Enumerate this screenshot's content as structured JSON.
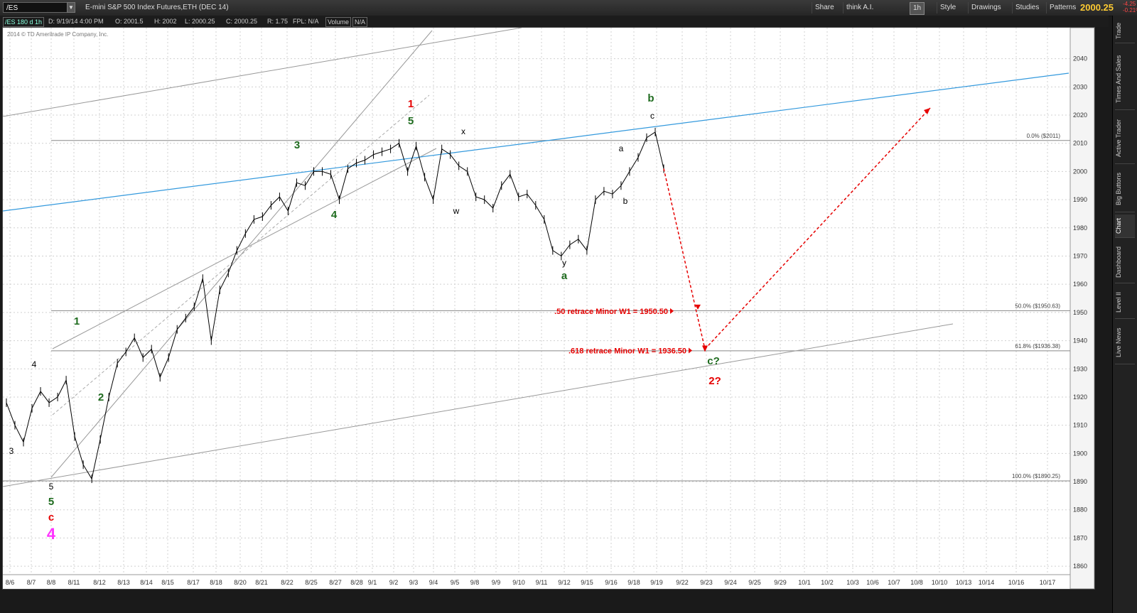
{
  "toolbar": {
    "symbol": "/ES",
    "description": "E-mini S&P 500 Index Futures,ETH (DEC 14)",
    "buttons": [
      "Share",
      "think A.I.",
      "1h",
      "Style",
      "Drawings",
      "Studies",
      "Patterns"
    ],
    "last_price": "2000.25",
    "change_abs": "-4.25",
    "change_pct": "-0.21%"
  },
  "infobar": {
    "series_label": "/ES 180 d 1h",
    "date": "D: 9/19/14 4:00 PM",
    "open": "O: 2001.5",
    "high": "H: 2002",
    "low": "L: 2000.25",
    "close": "C: 2000.25",
    "range": "R: 1.75",
    "fpl": "FPL: N/A",
    "volume": "Volume",
    "volume_value": "N/A"
  },
  "sidebar": {
    "tabs": [
      "Trade",
      "Times And Sales",
      "Active Trader",
      "Big Buttons",
      "Chart",
      "Dashboard",
      "Level II",
      "Live News"
    ]
  },
  "chart_data": {
    "type": "line",
    "copyright": "2014 © TD Ameritrade IP Company, Inc.",
    "x_ticks": [
      "8/6",
      "8/7",
      "8/8",
      "8/11",
      "8/12",
      "8/13",
      "8/14",
      "8/15",
      "8/17",
      "8/18",
      "8/20",
      "8/21",
      "8/22",
      "8/25",
      "8/27",
      "8/28",
      "9/1",
      "9/2",
      "9/3",
      "9/4",
      "9/5",
      "9/8",
      "9/9",
      "9/10",
      "9/11",
      "9/12",
      "9/15",
      "9/16",
      "9/18",
      "9/19",
      "9/22",
      "9/23",
      "9/24",
      "9/25",
      "9/29",
      "10/1",
      "10/2",
      "10/3",
      "10/6",
      "10/7",
      "10/8",
      "10/10",
      "10/13",
      "10/14",
      "10/16",
      "10/17"
    ],
    "y_ticks": [
      1860,
      1870,
      1880,
      1890,
      1900,
      1910,
      1920,
      1930,
      1940,
      1950,
      1960,
      1970,
      1980,
      1990,
      2000,
      2010,
      2020,
      2030,
      2040
    ],
    "ylim": [
      1857,
      2051
    ],
    "series": [
      {
        "x": [
          0,
          1,
          2,
          3,
          4,
          5,
          6,
          7,
          8,
          9,
          10,
          11,
          12,
          13,
          14,
          15,
          16,
          17,
          18,
          19,
          20,
          21,
          22,
          23,
          24,
          25,
          26,
          27,
          28,
          29,
          30,
          31,
          32,
          33,
          34,
          35,
          36,
          37,
          38,
          39,
          40,
          41,
          42,
          43,
          44,
          45,
          46,
          47,
          48,
          49,
          50,
          51,
          52,
          53,
          54,
          55,
          56,
          57,
          58,
          59,
          60,
          61,
          62,
          63,
          64,
          65,
          66,
          67,
          68,
          69,
          70,
          71,
          72,
          73,
          74,
          75,
          76,
          77
        ],
        "values": [
          1918,
          1910,
          1904,
          1916,
          1922,
          1918,
          1920,
          1926,
          1906,
          1896,
          1891,
          1905,
          1920,
          1932,
          1936,
          1941,
          1934,
          1937,
          1927,
          1934,
          1944,
          1948,
          1952,
          1962,
          1940,
          1958,
          1964,
          1972,
          1978,
          1983,
          1984,
          1988,
          1991,
          1986,
          1996,
          1995,
          2000,
          2000,
          1999,
          1990,
          2001,
          2003,
          2004,
          2006,
          2007,
          2008,
          2010,
          2000,
          2009,
          1998,
          1990,
          2008,
          2006,
          2002,
          2000,
          1991,
          1990,
          1987,
          1995,
          1999,
          1991,
          1992,
          1988,
          1983,
          1972,
          1970,
          1974,
          1976,
          1972,
          1990,
          1993,
          1992,
          1995,
          2000,
          2005,
          2012,
          2014,
          2001
        ]
      }
    ],
    "fib_levels": [
      {
        "label": "0.0%  ($2011)",
        "value": 2011
      },
      {
        "label": "50.0%  ($1950.63)",
        "value": 1950.63
      },
      {
        "label": "61.8%  ($1936.38)",
        "value": 1936.38
      },
      {
        "label": "100.0%  ($1890.25)",
        "value": 1890.25
      }
    ],
    "target_annotations": [
      {
        "text": ".50 retrace Minor W1 = 1950.50",
        "value": 1950.5
      },
      {
        "text": ".618 retrace Minor W1 = 1936.50",
        "value": 1936.5
      }
    ],
    "wave_labels": [
      {
        "text": "3",
        "color": "#000000",
        "size": "s"
      },
      {
        "text": "4",
        "color": "#000000",
        "size": "s"
      },
      {
        "text": "5",
        "color": "#000000",
        "size": "s"
      },
      {
        "text": "5",
        "color": "#1e6b1e",
        "size": "m"
      },
      {
        "text": "c",
        "color": "#e60000",
        "size": "m"
      },
      {
        "text": "4",
        "color": "#ff33ff",
        "size": "l"
      },
      {
        "text": "1",
        "color": "#1e6b1e",
        "size": "m"
      },
      {
        "text": "2",
        "color": "#1e6b1e",
        "size": "m"
      },
      {
        "text": "3",
        "color": "#1e6b1e",
        "size": "m"
      },
      {
        "text": "4",
        "color": "#1e6b1e",
        "size": "m"
      },
      {
        "text": "5",
        "color": "#1e6b1e",
        "size": "m"
      },
      {
        "text": "1",
        "color": "#e60000",
        "size": "m"
      },
      {
        "text": "x",
        "color": "#000000",
        "size": "s"
      },
      {
        "text": "w",
        "color": "#000000",
        "size": "s"
      },
      {
        "text": "y",
        "color": "#000000",
        "size": "s"
      },
      {
        "text": "a",
        "color": "#1e6b1e",
        "size": "m"
      },
      {
        "text": "a",
        "color": "#000000",
        "size": "s"
      },
      {
        "text": "b",
        "color": "#000000",
        "size": "s"
      },
      {
        "text": "c",
        "color": "#000000",
        "size": "s"
      },
      {
        "text": "b",
        "color": "#1e6b1e",
        "size": "m"
      },
      {
        "text": "c?",
        "color": "#1e6b1e",
        "size": "m"
      },
      {
        "text": "2?",
        "color": "#e60000",
        "size": "m"
      }
    ],
    "colors": {
      "price": "#000000",
      "trendline_blue": "#3399dd",
      "channel": "#999999",
      "fib": "#888888",
      "projection": "#e60000"
    }
  }
}
